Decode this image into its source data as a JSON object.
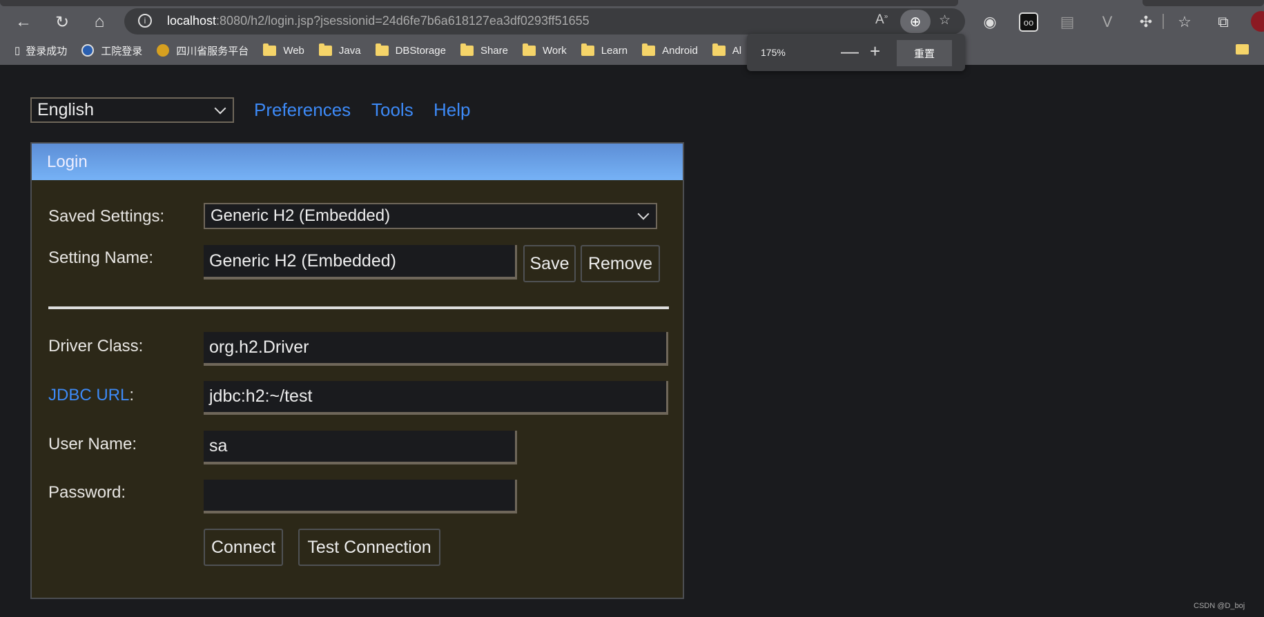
{
  "browser": {
    "url_host": "localhost",
    "url_rest": ":8080/h2/login.jsp?jsessionid=24d6fe7b6a618127ea3df0293ff51655",
    "bookmarks": [
      {
        "label": "登录成功",
        "icon": "page-icon"
      },
      {
        "label": "工院登录",
        "icon": "site-logo-icon"
      },
      {
        "label": "四川省服务平台",
        "icon": "site-logo-icon"
      },
      {
        "label": "Web",
        "icon": "folder-icon"
      },
      {
        "label": "Java",
        "icon": "folder-icon"
      },
      {
        "label": "DBStorage",
        "icon": "folder-icon"
      },
      {
        "label": "Share",
        "icon": "folder-icon"
      },
      {
        "label": "Work",
        "icon": "folder-icon"
      },
      {
        "label": "Learn",
        "icon": "folder-icon"
      },
      {
        "label": "Android",
        "icon": "folder-icon"
      },
      {
        "label": "Al",
        "icon": "folder-icon"
      }
    ],
    "zoom_popup": {
      "level": "175%",
      "minus": "—",
      "plus": "+",
      "reset": "重置"
    }
  },
  "topbar": {
    "language": "English",
    "links": [
      "Preferences",
      "Tools",
      "Help"
    ],
    "link_color": "#3d8af7"
  },
  "login": {
    "title": "Login",
    "saved_settings_label": "Saved Settings:",
    "saved_settings_value": "Generic H2 (Embedded)",
    "setting_name_label": "Setting Name:",
    "setting_name_value": "Generic H2 (Embedded)",
    "save": "Save",
    "remove": "Remove",
    "driver_label": "Driver Class:",
    "driver_value": "org.h2.Driver",
    "jdbc_label": "JDBC URL",
    "jdbc_colon": ":",
    "jdbc_value": "jdbc:h2:~/test",
    "user_label": "User Name:",
    "user_value": "sa",
    "password_label": "Password:",
    "password_value": "",
    "connect": "Connect",
    "test": "Test Connection"
  },
  "watermark": "CSDN @D_boj"
}
